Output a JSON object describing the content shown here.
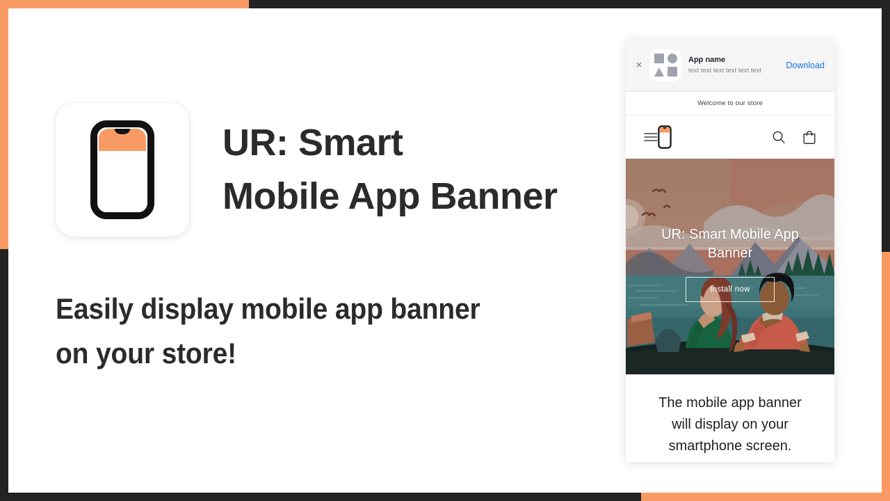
{
  "frame": {
    "orange": "#f99a64",
    "dark": "#232323"
  },
  "left": {
    "app_icon_name": "phone-app-icon",
    "title": "UR: Smart\nMobile App Banner",
    "tagline": "Easily display mobile app banner\non your store!"
  },
  "phone_preview": {
    "smart_banner": {
      "close_label": "×",
      "app_name": "App name",
      "app_description": "text text text text text text",
      "download_label": "Download",
      "download_color": "#1a73e8"
    },
    "announcement": "Welcome to our store",
    "store_header": {
      "menu_icon": "hamburger-menu-icon",
      "logo_icon": "phone-logo-icon",
      "search_icon": "search-icon",
      "cart_icon": "shopping-bag-icon"
    },
    "hero": {
      "title": "UR: Smart Mobile App Banner",
      "cta_label": "Install now",
      "illustration": "canoe-lake-mountains-illustration"
    },
    "caption": "The mobile app banner\nwill display on your\nsmartphone screen."
  }
}
